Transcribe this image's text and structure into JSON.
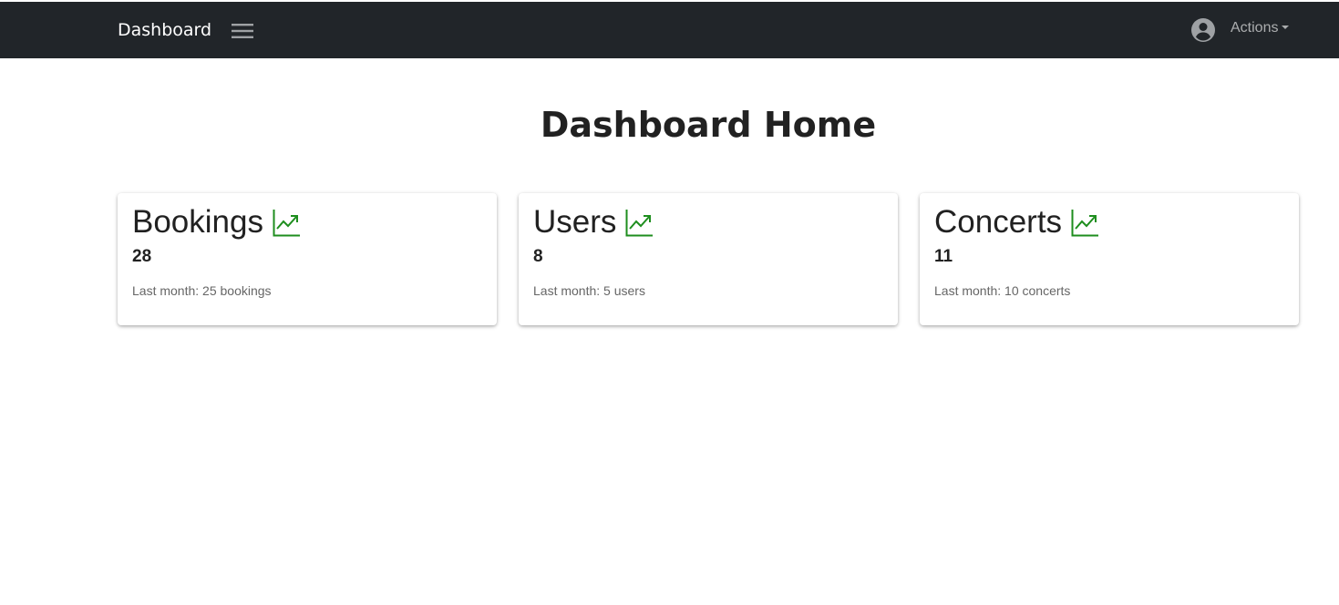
{
  "navbar": {
    "brand": "Dashboard",
    "menu_icon": "hamburger-menu-icon",
    "avatar_icon": "account-circle-icon",
    "actions_label": "Actions"
  },
  "page": {
    "title": "Dashboard Home"
  },
  "colors": {
    "navbar_bg": "#212529",
    "trend_green": "#1e8e1e"
  },
  "cards": [
    {
      "title": "Bookings",
      "icon": "trending-up-icon",
      "value": "28",
      "subtitle": "Last month: 25 bookings"
    },
    {
      "title": "Users",
      "icon": "trending-up-icon",
      "value": "8",
      "subtitle": "Last month: 5 users"
    },
    {
      "title": "Concerts",
      "icon": "trending-up-icon",
      "value": "11",
      "subtitle": "Last month: 10 concerts"
    }
  ]
}
